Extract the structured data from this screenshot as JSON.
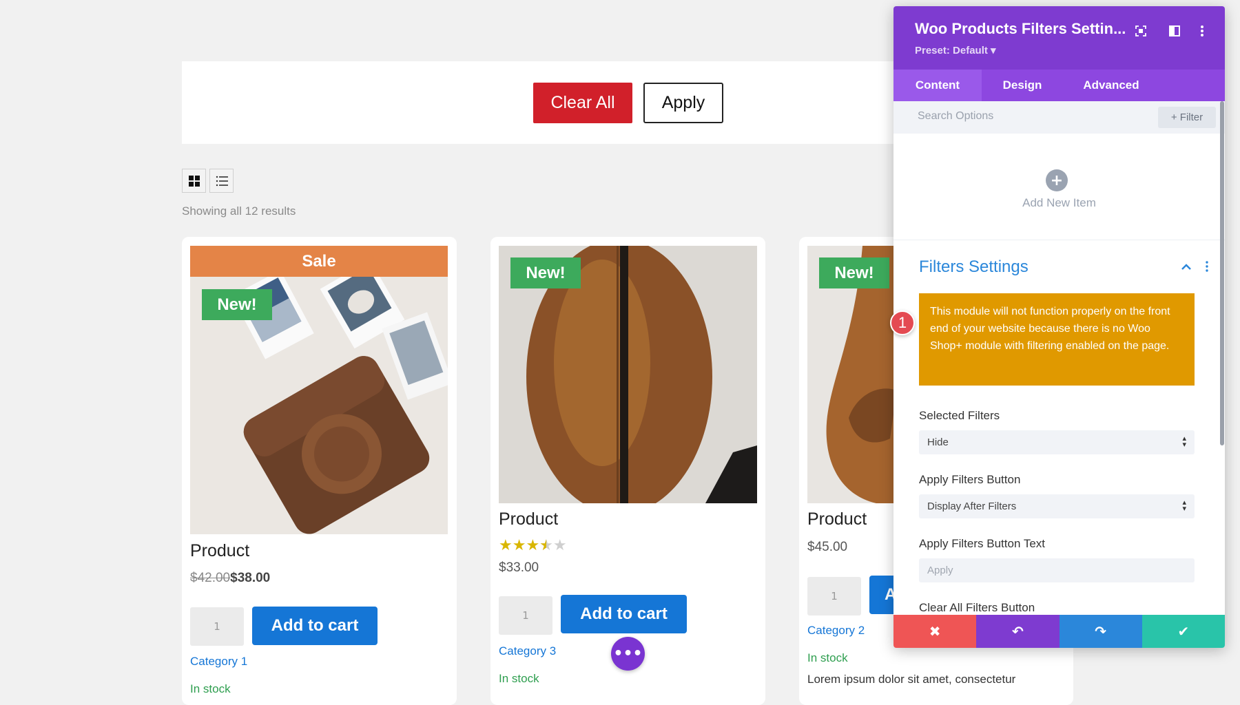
{
  "filter_bar": {
    "clear_label": "Clear All",
    "apply_label": "Apply"
  },
  "view": {
    "grid_icon": "grid-icon",
    "list_icon": "list-icon"
  },
  "results_text": "Showing all 12 results",
  "products": [
    {
      "sale": "Sale",
      "badge": "New!",
      "title": "Product",
      "old_price": "$42.00",
      "price": "$38.00",
      "qty": "1",
      "add_label": "Add to cart",
      "category": "Category 1",
      "stock": "In stock"
    },
    {
      "badge": "New!",
      "title": "Product",
      "rating": 3.5,
      "price": "$33.00",
      "qty": "1",
      "add_label": "Add to cart",
      "category": "Category 3",
      "stock": "In stock"
    },
    {
      "badge": "New!",
      "title": "Product",
      "price": "$45.00",
      "qty": "1",
      "add_label": "Add to cart",
      "category": "Category 2",
      "stock": "In stock",
      "description": "Lorem ipsum dolor sit amet, consectetur"
    }
  ],
  "fab_label": "•••",
  "panel": {
    "title": "Woo Products Filters Settin...",
    "preset": "Preset: Default ▾",
    "tabs": [
      "Content",
      "Design",
      "Advanced"
    ],
    "active_tab": "Content",
    "search_placeholder": "Search Options",
    "filter_label": "+ Filter",
    "add_new_label": "Add New Item",
    "section_title": "Filters Settings",
    "warning_badge": "1",
    "warning": "This module will not function properly on the front end of your website because there is no Woo Shop+ module with filtering enabled on the page.",
    "fields": [
      {
        "label": "Selected Filters",
        "value": "Hide"
      },
      {
        "label": "Apply Filters Button",
        "value": "Display After Filters"
      },
      {
        "label": "Apply Filters Button Text",
        "placeholder": "Apply"
      },
      {
        "label": "Clear All Filters Button"
      }
    ],
    "footer": {
      "cancel": "✖",
      "undo": "↶",
      "redo": "↷",
      "save": "✔"
    }
  },
  "colors": {
    "panel_header": "#7e3bd0",
    "accent_blue": "#1576d6",
    "warning": "#e09900",
    "clear_red": "#d1202a",
    "new_green": "#3daa5c"
  }
}
